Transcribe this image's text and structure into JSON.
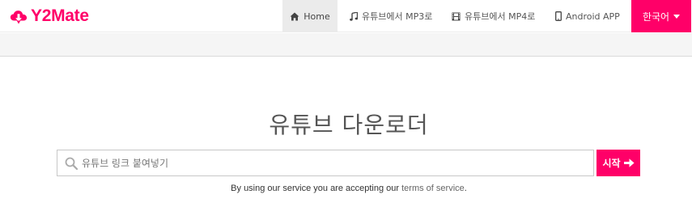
{
  "brand": {
    "name": "Y2Mate",
    "color": "#ff0068"
  },
  "nav": {
    "items": [
      {
        "label": "Home",
        "icon": "home-icon",
        "active": true
      },
      {
        "label": "유튜브에서 MP3로",
        "icon": "music-note-icon",
        "active": false
      },
      {
        "label": "유튜브에서 MP4로",
        "icon": "film-icon",
        "active": false
      },
      {
        "label": "Android APP",
        "icon": "mobile-phone-icon",
        "active": false
      }
    ],
    "language": {
      "label": "한국어",
      "icon": "caret-down-icon"
    }
  },
  "main": {
    "title": "유튜브 다운로더",
    "search": {
      "placeholder": "유튜브 링크 붙여넣기",
      "value": "",
      "icon": "search-icon"
    },
    "start_button": {
      "label": "시작",
      "icon": "arrow-right-icon"
    },
    "terms": {
      "prefix": "By using our service you are accepting our ",
      "link": "terms of service",
      "suffix": "."
    }
  },
  "colors": {
    "accent": "#ff0068",
    "nav_active_bg": "#ebebeb",
    "subbar_bg": "#f5f5f5"
  }
}
